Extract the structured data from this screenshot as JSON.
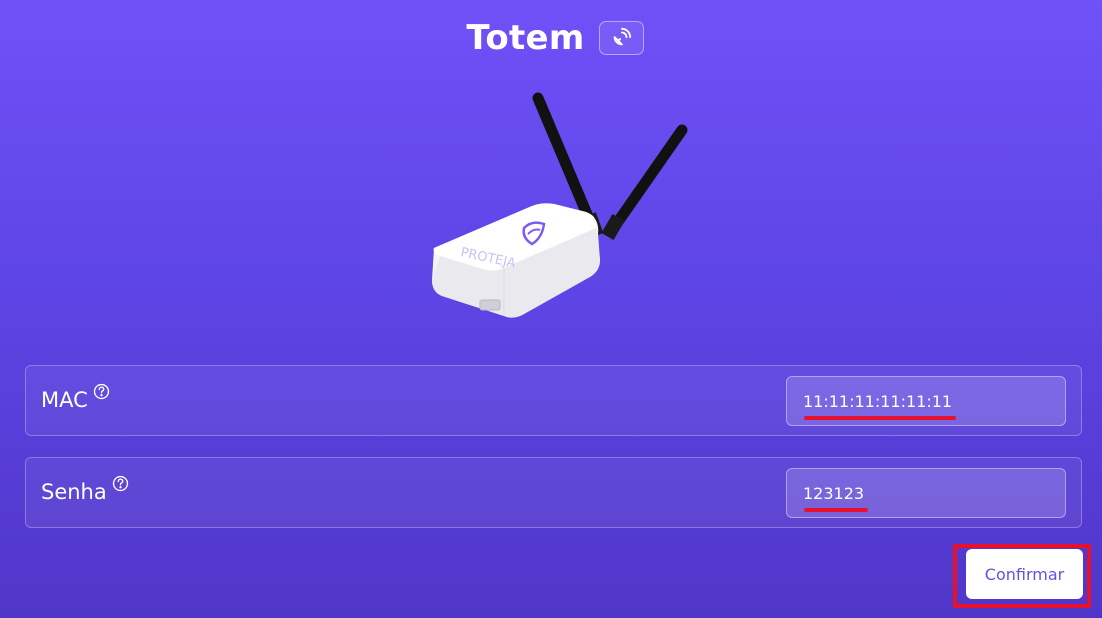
{
  "header": {
    "title": "Totem",
    "action_icon": "satellite-dish-icon"
  },
  "device": {
    "image": "totem-router-device",
    "logo_text": "PROTEJA"
  },
  "form": {
    "mac": {
      "label": "MAC",
      "help_icon": "question-circle-icon",
      "value": "11:11:11:11:11:11"
    },
    "senha": {
      "label": "Senha",
      "help_icon": "question-circle-icon",
      "value": "123123"
    }
  },
  "actions": {
    "confirm_label": "Confirmar"
  },
  "colors": {
    "background_top": "#6f51f8",
    "background_bottom": "#5036c8",
    "accent_text": "#6a4de8",
    "annotation_red": "#e8112d"
  }
}
